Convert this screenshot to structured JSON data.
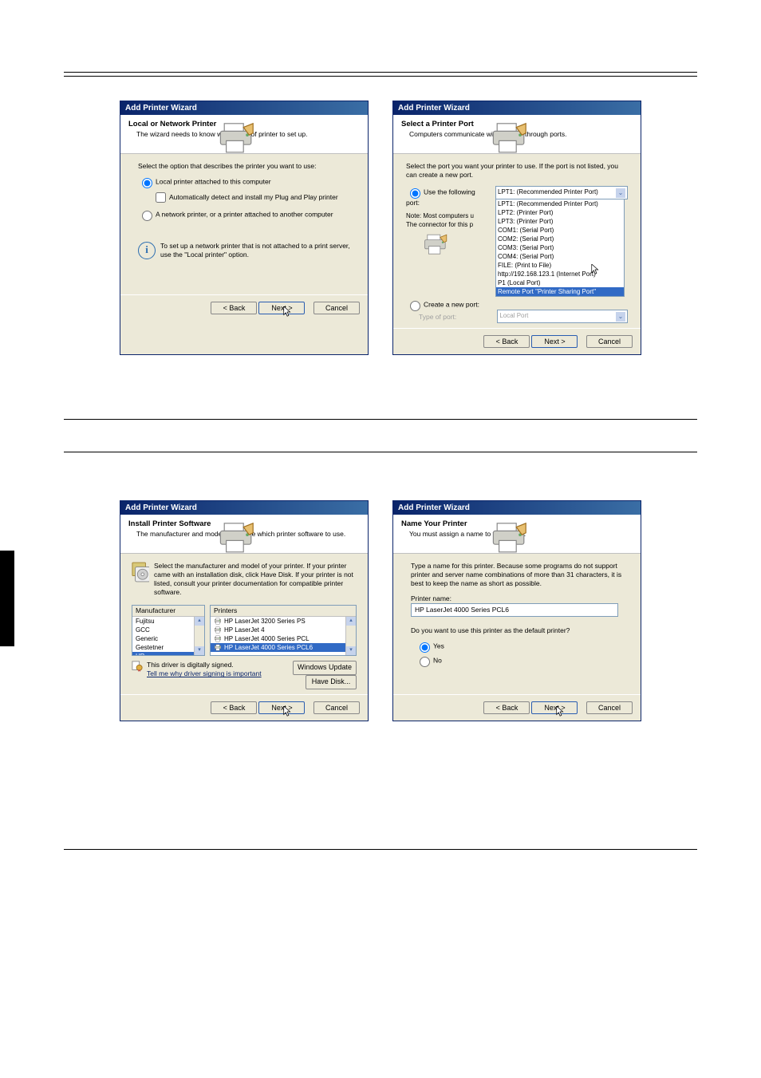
{
  "wizard_title": "Add Printer Wizard",
  "buttons": {
    "back": "< Back",
    "next": "Next >",
    "cancel": "Cancel",
    "winupdate": "Windows Update",
    "havedisk": "Have Disk..."
  },
  "d1": {
    "h_title": "Local or Network Printer",
    "h_sub": "The wizard needs to know which type of printer to set up.",
    "prompt": "Select the option that describes the printer you want to use:",
    "opt_local": "Local printer attached to this computer",
    "chk_auto": "Automatically detect and install my Plug and Play printer",
    "opt_net": "A network printer, or a printer attached to another computer",
    "info": "To set up a network printer that is not attached to a print server, use the \"Local printer\" option."
  },
  "d2": {
    "h_title": "Select a Printer Port",
    "h_sub": "Computers communicate with printers through ports.",
    "prompt": "Select the port you want your printer to use. If the port is not listed, you can create a new port.",
    "opt_use": "Use the following port:",
    "sel": "LPT1: (Recommended Printer Port)",
    "note1": "Note: Most computers u",
    "note2": "The connector for this p",
    "opt_new": "Create a new port:",
    "type_lbl": "Type of port:",
    "type_val": "Local Port",
    "ports": [
      "LPT1: (Recommended Printer Port)",
      "LPT2: (Printer Port)",
      "LPT3: (Printer Port)",
      "COM1: (Serial Port)",
      "COM2: (Serial Port)",
      "COM3: (Serial Port)",
      "COM4: (Serial Port)",
      "FILE: (Print to File)",
      "http://192.168.123.1 (Internet Port)",
      "P1 (Local Port)",
      "Remote Port \"Printer Sharing Port\""
    ]
  },
  "d3": {
    "h_title": "Install Printer Software",
    "h_sub": "The manufacturer and model determine which printer software to use.",
    "instr": "Select the manufacturer and model of your printer. If your printer came with an installation disk, click Have Disk. If your printer is not listed, consult your printer documentation for compatible printer software.",
    "col_manu": "Manufacturer",
    "col_prn": "Printers",
    "manus": [
      "Fujitsu",
      "GCC",
      "Generic",
      "Gestetner",
      "HP"
    ],
    "prns": [
      "HP LaserJet 3200 Series PS",
      "HP LaserJet 4",
      "HP LaserJet 4000 Series PCL",
      "HP LaserJet 4000 Series PCL6"
    ],
    "signed": "This driver is digitally signed.",
    "whylink": "Tell me why driver signing is important"
  },
  "d4": {
    "h_title": "Name Your Printer",
    "h_sub": "You must assign a name to this printer.",
    "instr": "Type a name for this printer. Because some programs do not support printer and server name combinations of more than 31 characters, it is best to keep the name as short as possible.",
    "name_lbl": "Printer name:",
    "name_val": "HP LaserJet 4000 Series PCL6",
    "default_q": "Do you want to use this printer as the default printer?",
    "yes": "Yes",
    "no": "No"
  }
}
